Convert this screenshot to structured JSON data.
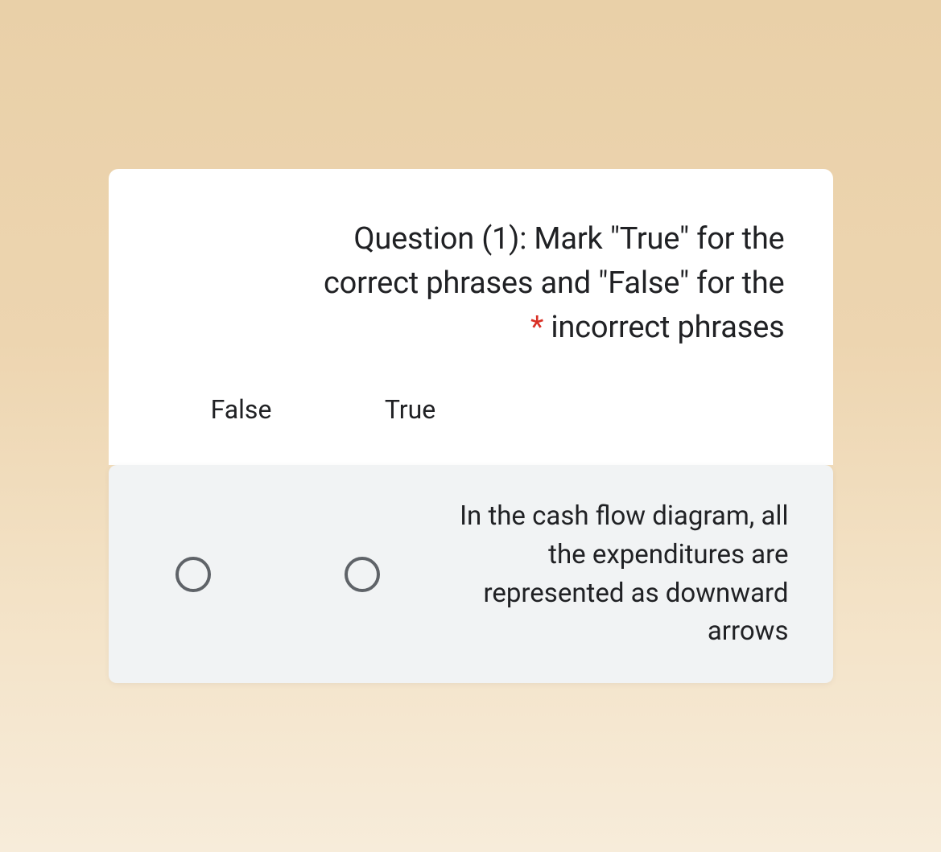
{
  "question": {
    "title_line1": "Question (1): Mark \"True\" for the",
    "title_line2": "correct phrases and \"False\" for the",
    "title_line3_suffix": " incorrect phrases",
    "required_marker": "*"
  },
  "headers": {
    "col0": "False",
    "col1": "True"
  },
  "row": {
    "text": "In the cash flow diagram, all the expenditures are represented as downward arrows"
  }
}
